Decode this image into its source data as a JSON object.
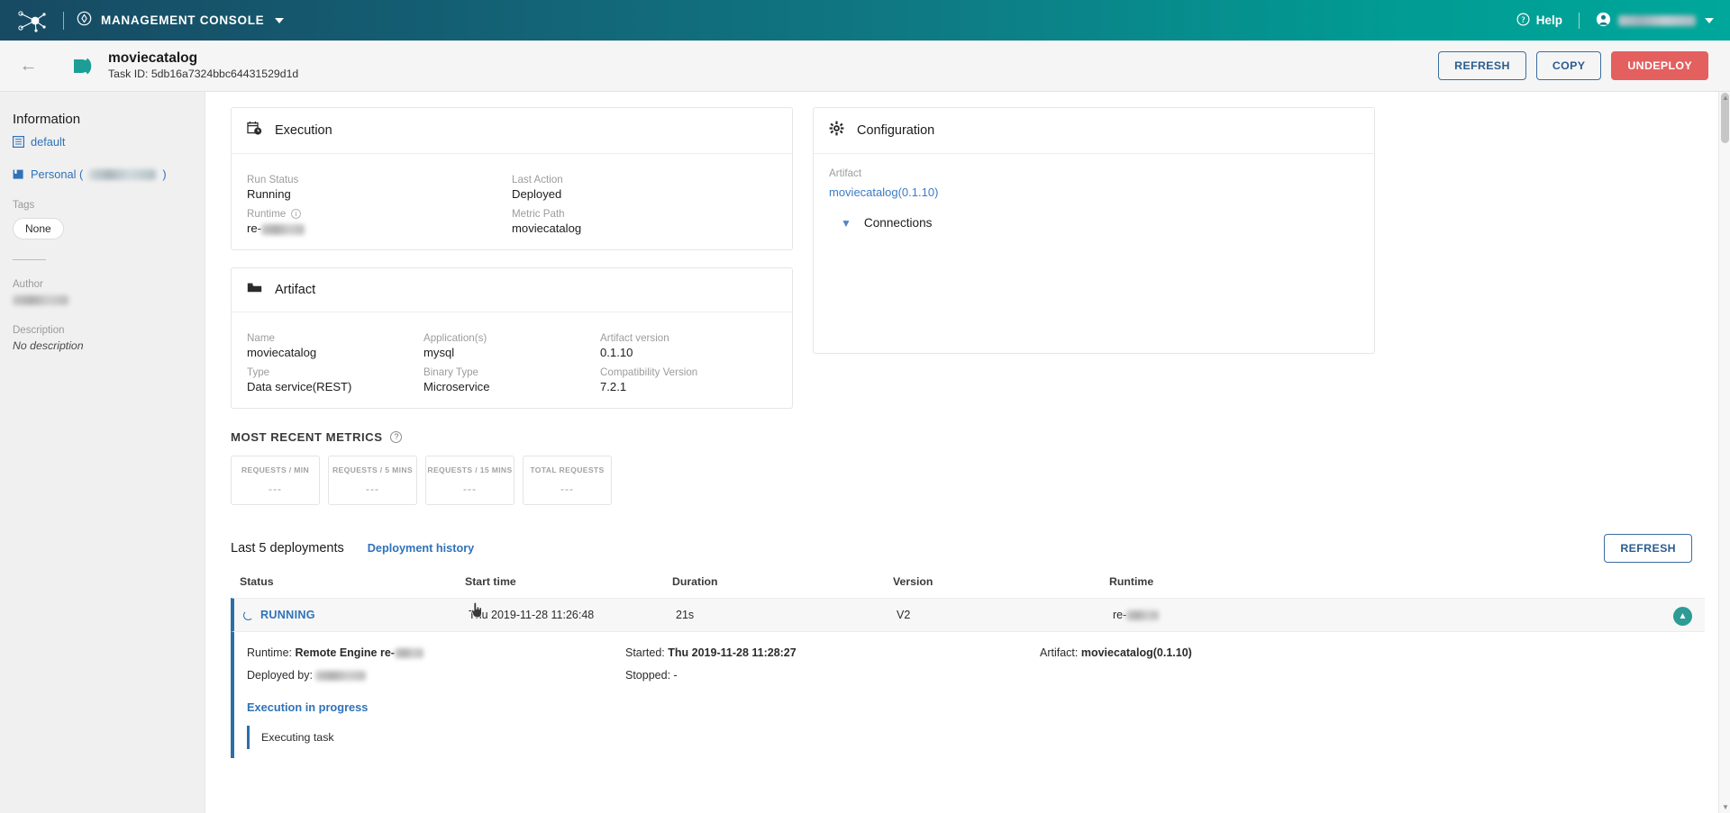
{
  "topbar": {
    "logo_icon": "network-graph-logo",
    "console_icon": "compass-icon",
    "console_label": "MANAGEMENT CONSOLE",
    "caret_icon": "chevron-down-icon",
    "help_icon": "question-circle-icon",
    "help_label": "Help",
    "avatar_icon": "user-avatar-icon",
    "user_name": "██████████",
    "user_caret_icon": "chevron-down-icon"
  },
  "pagehead": {
    "back_icon": "arrow-left-icon",
    "task_icon": "data-service-icon",
    "title": "moviecatalog",
    "subtitle": "Task ID: 5db16a7324bbc64431529d1d",
    "buttons": [
      {
        "label": "REFRESH",
        "style": "outline",
        "name": "refresh-button"
      },
      {
        "label": "COPY",
        "style": "outline",
        "name": "copy-button"
      },
      {
        "label": "UNDEPLOY",
        "style": "danger",
        "name": "undeploy-button"
      }
    ]
  },
  "sidebar": {
    "heading": "Information",
    "workspace_icon": "list-document-icon",
    "workspace": "default",
    "project_icon": "folder-box-icon",
    "project_prefix": "Personal (",
    "project_name": "█████████",
    "project_suffix": ")",
    "tags_label": "Tags",
    "tags_value": "None",
    "author_label": "Author",
    "author_value": "████████",
    "description_label": "Description",
    "description_value": "No description"
  },
  "execution": {
    "icon": "calendar-clock-icon",
    "title": "Execution",
    "fields": {
      "run_status_label": "Run Status",
      "run_status_value": "Running",
      "last_action_label": "Last Action",
      "last_action_value": "Deployed",
      "runtime_label": "Runtime",
      "runtime_info_icon": "info-circle-icon",
      "runtime_value_prefix": "re-",
      "runtime_value_redacted": "█████",
      "metric_path_label": "Metric Path",
      "metric_path_value": "moviecatalog"
    }
  },
  "artifact": {
    "icon": "folder-icon",
    "title": "Artifact",
    "fields": {
      "name_label": "Name",
      "name_value": "moviecatalog",
      "applications_label": "Application(s)",
      "applications_value": "mysql",
      "artifact_version_label": "Artifact version",
      "artifact_version_value": "0.1.10",
      "type_label": "Type",
      "type_value": "Data service(REST)",
      "binary_type_label": "Binary Type",
      "binary_type_value": "Microservice",
      "compatibility_label": "Compatibility Version",
      "compatibility_value": "7.2.1"
    }
  },
  "configuration": {
    "icon": "gear-icon",
    "title": "Configuration",
    "artifact_label": "Artifact",
    "artifact_link": "moviecatalog(0.1.10)",
    "connections_chevron_icon": "chevron-down-icon",
    "connections_label": "Connections"
  },
  "metrics": {
    "title": "MOST RECENT METRICS",
    "help_icon": "question-circle-icon",
    "cards": [
      {
        "label": "REQUESTS / MIN",
        "value": "---"
      },
      {
        "label": "REQUESTS / 5 MINS",
        "value": "---"
      },
      {
        "label": "REQUESTS / 15 MINS",
        "value": "---"
      },
      {
        "label": "TOTAL REQUESTS",
        "value": "---"
      }
    ]
  },
  "deployments": {
    "title": "Last 5 deployments",
    "history_link": "Deployment history",
    "refresh_label": "REFRESH",
    "columns": [
      "Status",
      "Start time",
      "Duration",
      "Version",
      "Runtime"
    ],
    "row": {
      "status_icon": "spinner-icon",
      "status": "RUNNING",
      "cursor_icon": "hand-pointer-icon",
      "start_time": "Thu 2019-11-28 11:26:48",
      "duration": "21s",
      "version": "V2",
      "runtime_prefix": "re-",
      "runtime_redacted": "█████",
      "collapse_icon": "chevron-up-icon"
    },
    "detail": {
      "runtime_label": "Runtime:",
      "runtime_value": "Remote Engine re-",
      "runtime_redacted": "████",
      "started_label": "Started:",
      "started_value": "Thu 2019-11-28 11:28:27",
      "artifact_label": "Artifact:",
      "artifact_value": "moviecatalog(0.1.10)",
      "deployed_by_label": "Deployed by:",
      "deployed_by_value": "███████",
      "stopped_label": "Stopped:",
      "stopped_value": "-",
      "execution_progress": "Execution in progress",
      "log_line": "Executing task"
    }
  },
  "colors": {
    "accent_teal": "#00A79A",
    "header_dark": "#174A63",
    "link_blue": "#2f72b8",
    "danger_red": "#e3605f",
    "row_accent": "#2C6FA8"
  }
}
